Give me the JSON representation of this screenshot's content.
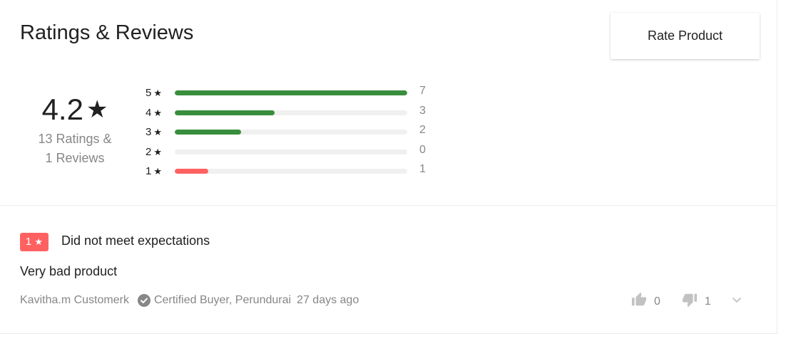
{
  "header": {
    "title": "Ratings & Reviews",
    "rate_button": "Rate Product"
  },
  "summary": {
    "average": "4.2",
    "star_glyph": "★",
    "ratings_text": "13 Ratings &",
    "reviews_text": "1 Reviews"
  },
  "distribution": [
    {
      "stars": "5",
      "count": "7",
      "fraction": 1.0,
      "color": "#388e3c"
    },
    {
      "stars": "4",
      "count": "3",
      "fraction": 0.429,
      "color": "#388e3c"
    },
    {
      "stars": "3",
      "count": "2",
      "fraction": 0.286,
      "color": "#388e3c"
    },
    {
      "stars": "2",
      "count": "0",
      "fraction": 0.0,
      "color": "#388e3c"
    },
    {
      "stars": "1",
      "count": "1",
      "fraction": 0.143,
      "color": "#ff6161"
    }
  ],
  "review": {
    "rating": "1",
    "badge_color": "#ff6161",
    "title": "Did not meet expectations",
    "text": "Very bad product",
    "author": "Kavitha.m Customerk",
    "certified": "Certified Buyer, Perundurai",
    "date": "27 days ago",
    "likes": "0",
    "dislikes": "1",
    "icons": {
      "certified": "check-circle-icon",
      "like": "thumbs-up-icon",
      "dislike": "thumbs-down-icon",
      "expand": "chevron-down-icon"
    }
  }
}
